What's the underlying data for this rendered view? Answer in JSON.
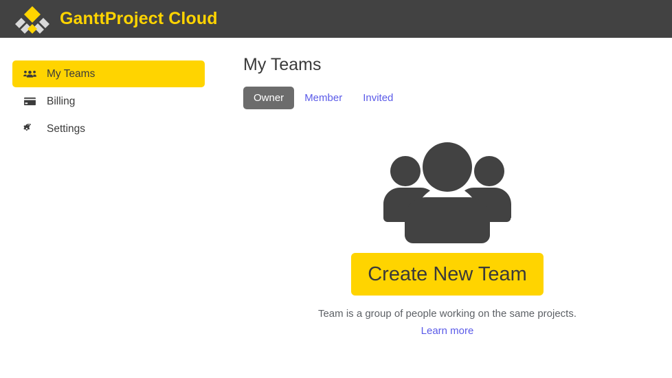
{
  "header": {
    "title": "GanttProject Cloud",
    "logo_icon": "ganttproject-diamond-logo",
    "background_color": "#424242",
    "title_color": "#FFD400"
  },
  "sidebar": {
    "items": [
      {
        "label": "My Teams",
        "icon": "users-icon",
        "active": true
      },
      {
        "label": "Billing",
        "icon": "credit-card-icon",
        "active": false
      },
      {
        "label": "Settings",
        "icon": "cogs-icon",
        "active": false
      }
    ],
    "active_background_color": "#FFD400"
  },
  "main": {
    "page_title": "My Teams",
    "tabs": [
      {
        "label": "Owner",
        "active": true
      },
      {
        "label": "Member",
        "active": false
      },
      {
        "label": "Invited",
        "active": false
      }
    ],
    "active_tab_background_color": "#6c6c6c",
    "link_color": "#5a5ae8",
    "empty_state": {
      "icon": "users-group-icon",
      "icon_color": "#424242",
      "create_button_label": "Create New Team",
      "create_button_color": "#FFD400",
      "caption": "Team is a group of people working on the same projects.",
      "learn_more_label": "Learn more"
    }
  }
}
